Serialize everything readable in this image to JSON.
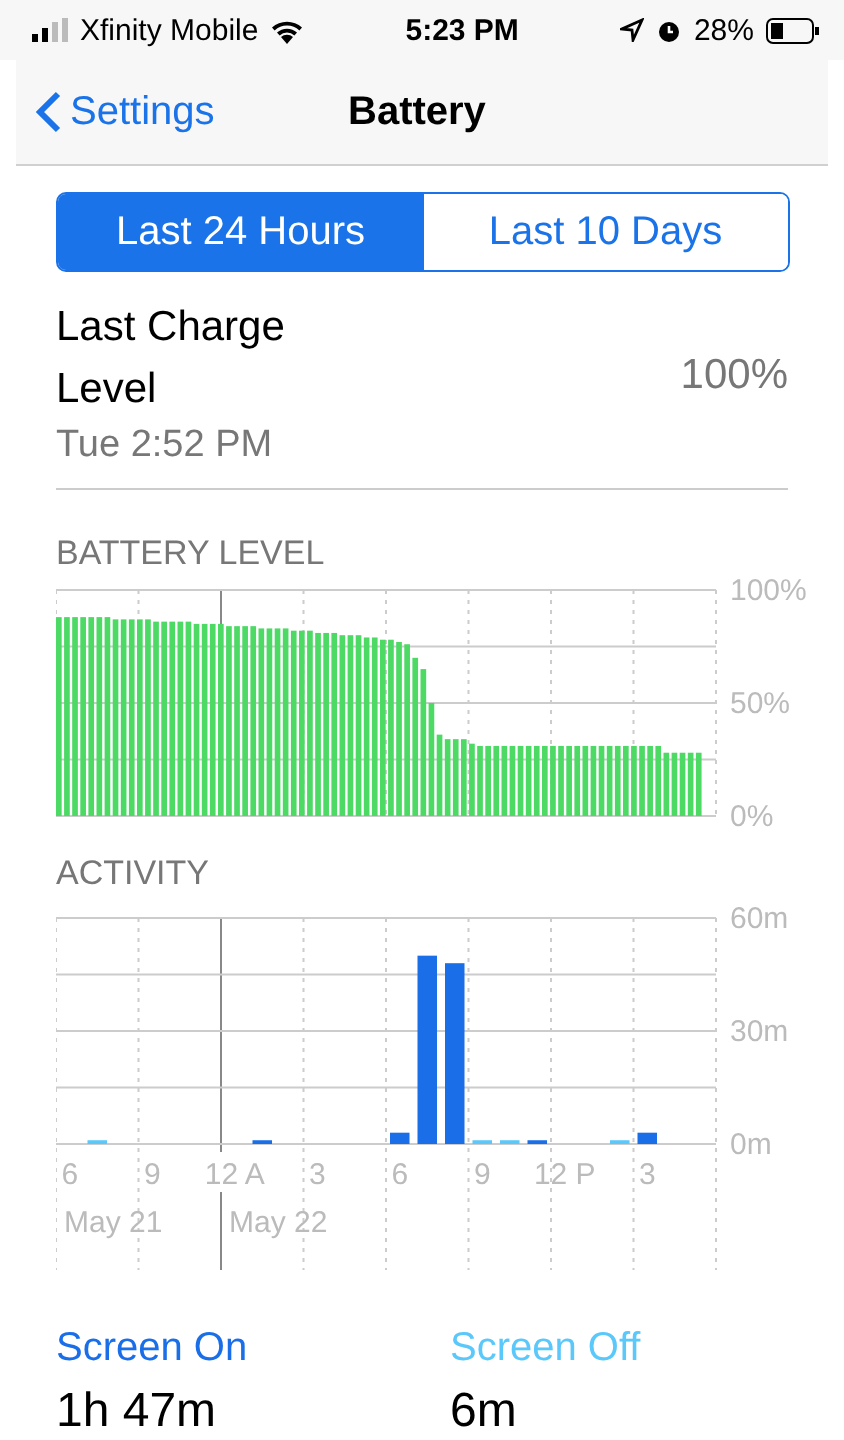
{
  "status_bar": {
    "carrier": "Xfinity Mobile",
    "time": "5:23 PM",
    "battery": "28%"
  },
  "nav": {
    "back": "Settings",
    "title": "Battery"
  },
  "tabs": [
    {
      "label": "Last 24 Hours",
      "selected": true
    },
    {
      "label": "Last 10 Days",
      "selected": false
    }
  ],
  "last_charge": {
    "label": "Last Charge Level",
    "time": "Tue 2:52 PM",
    "value": "100%"
  },
  "battery_level": {
    "title": "BATTERY LEVEL",
    "chart_data": {
      "type": "bar",
      "ylim": [
        0,
        100
      ],
      "yticks": [
        {
          "value": 0,
          "label": "0%"
        },
        {
          "value": 50,
          "label": "50%"
        },
        {
          "value": 100,
          "label": "100%"
        }
      ],
      "series": [
        {
          "color": "#4cd964",
          "values": [
            88,
            88,
            88,
            88,
            88,
            88,
            88,
            87,
            87,
            87,
            87,
            87,
            86,
            86,
            86,
            86,
            86,
            85,
            85,
            85,
            85,
            84,
            84,
            84,
            84,
            83,
            83,
            83,
            83,
            82,
            82,
            82,
            81,
            81,
            81,
            80,
            80,
            80,
            79,
            79,
            78,
            78,
            77,
            76,
            70,
            65,
            50,
            36,
            34,
            34,
            34,
            32,
            31,
            31,
            31,
            31,
            31,
            31,
            31,
            31,
            31,
            31,
            31,
            31,
            31,
            31,
            31,
            31,
            31,
            31,
            31,
            31,
            31,
            31,
            31,
            28,
            28,
            28,
            28,
            28
          ]
        }
      ]
    }
  },
  "activity": {
    "title": "ACTIVITY",
    "chart_data": {
      "type": "bar",
      "stacked": true,
      "ylim": [
        0,
        60
      ],
      "yticks": [
        {
          "value": 0,
          "label": "0m"
        },
        {
          "value": 30,
          "label": "30m"
        },
        {
          "value": 60,
          "label": "60m"
        }
      ],
      "categories": [
        "6",
        null,
        null,
        "9",
        null,
        null,
        "12 A",
        null,
        null,
        "3",
        null,
        null,
        "6",
        null,
        null,
        "9",
        null,
        null,
        "12 P",
        null,
        null,
        "3",
        null,
        null
      ],
      "series": [
        {
          "name": "Screen On",
          "color": "#1a6fe8",
          "values": [
            0,
            0,
            0,
            0,
            0,
            0,
            0,
            1,
            0,
            0,
            0,
            0,
            3,
            50,
            48,
            0,
            0,
            1,
            0,
            0,
            0,
            3,
            0,
            0
          ]
        },
        {
          "name": "Screen Off",
          "color": "#5ac8fa",
          "values": [
            0,
            1,
            0,
            0,
            0,
            0,
            0,
            0,
            0,
            0,
            0,
            0,
            0,
            0,
            0,
            1,
            1,
            0,
            0,
            0,
            1,
            0,
            0,
            0
          ]
        }
      ]
    },
    "dates": [
      "May 21",
      "May 22"
    ]
  },
  "screen_time": [
    "1h 47m",
    "6m"
  ]
}
